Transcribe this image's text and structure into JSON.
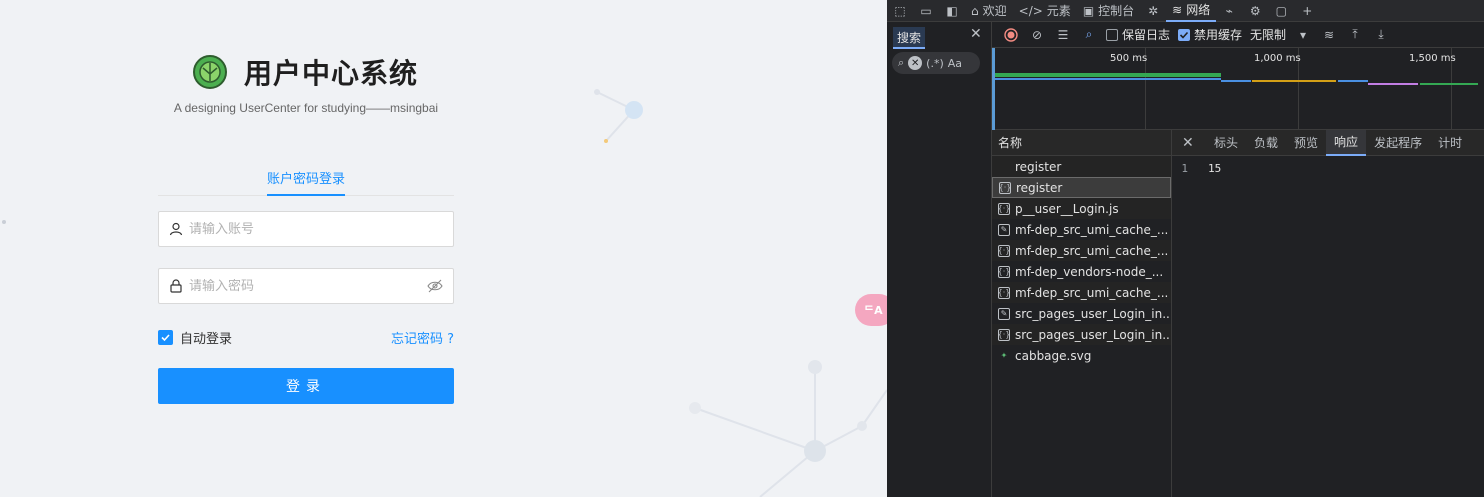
{
  "login": {
    "title": "用户中心系统",
    "subtitle": "A designing UserCenter for studying——msingbai",
    "tab_label": "账户密码登录",
    "username_placeholder": "请输入账号",
    "password_placeholder": "请输入密码",
    "remember_label": "自动登录",
    "remember_checked": true,
    "forgot_label": "忘记密码 ?",
    "submit_label": "登录",
    "brand_color": "#1890ff"
  },
  "translate_fab": {
    "label": "ᄃA"
  },
  "devtools": {
    "top_tabs": [
      {
        "label": "欢迎",
        "icon": "home-icon"
      },
      {
        "label": "元素",
        "icon": "code-icon"
      },
      {
        "label": "控制台",
        "icon": "console-icon"
      },
      {
        "label": "网络",
        "icon": "wifi-icon",
        "active": true
      }
    ],
    "search_tab_label": "搜索",
    "search_aa": "Aa",
    "search_regex": "(.*)",
    "toolbar": {
      "preserve_log_label": "保留日志",
      "preserve_log_checked": false,
      "disable_cache_label": "禁用缓存",
      "disable_cache_checked": true,
      "throttling_label": "无限制"
    },
    "timeline_ticks": [
      "500 ms",
      "1,000 ms",
      "1,500 ms"
    ],
    "requests_header": "名称",
    "requests": [
      {
        "name": "register",
        "type": "blank"
      },
      {
        "name": "register",
        "type": "fetch",
        "selected": true
      },
      {
        "name": "p__user__Login.js",
        "type": "script"
      },
      {
        "name": "mf-dep_src_umi_cache_...",
        "type": "edit"
      },
      {
        "name": "mf-dep_src_umi_cache_...",
        "type": "script"
      },
      {
        "name": "mf-dep_vendors-node_...",
        "type": "script"
      },
      {
        "name": "mf-dep_src_umi_cache_...",
        "type": "script"
      },
      {
        "name": "src_pages_user_Login_in...",
        "type": "edit"
      },
      {
        "name": "src_pages_user_Login_in...",
        "type": "script"
      },
      {
        "name": "cabbage.svg",
        "type": "svg"
      }
    ],
    "detail_tabs": [
      "标头",
      "负载",
      "预览",
      "响应",
      "发起程序",
      "计时"
    ],
    "active_detail_tab": "响应",
    "response": {
      "line_number": "1",
      "content": "15"
    }
  }
}
